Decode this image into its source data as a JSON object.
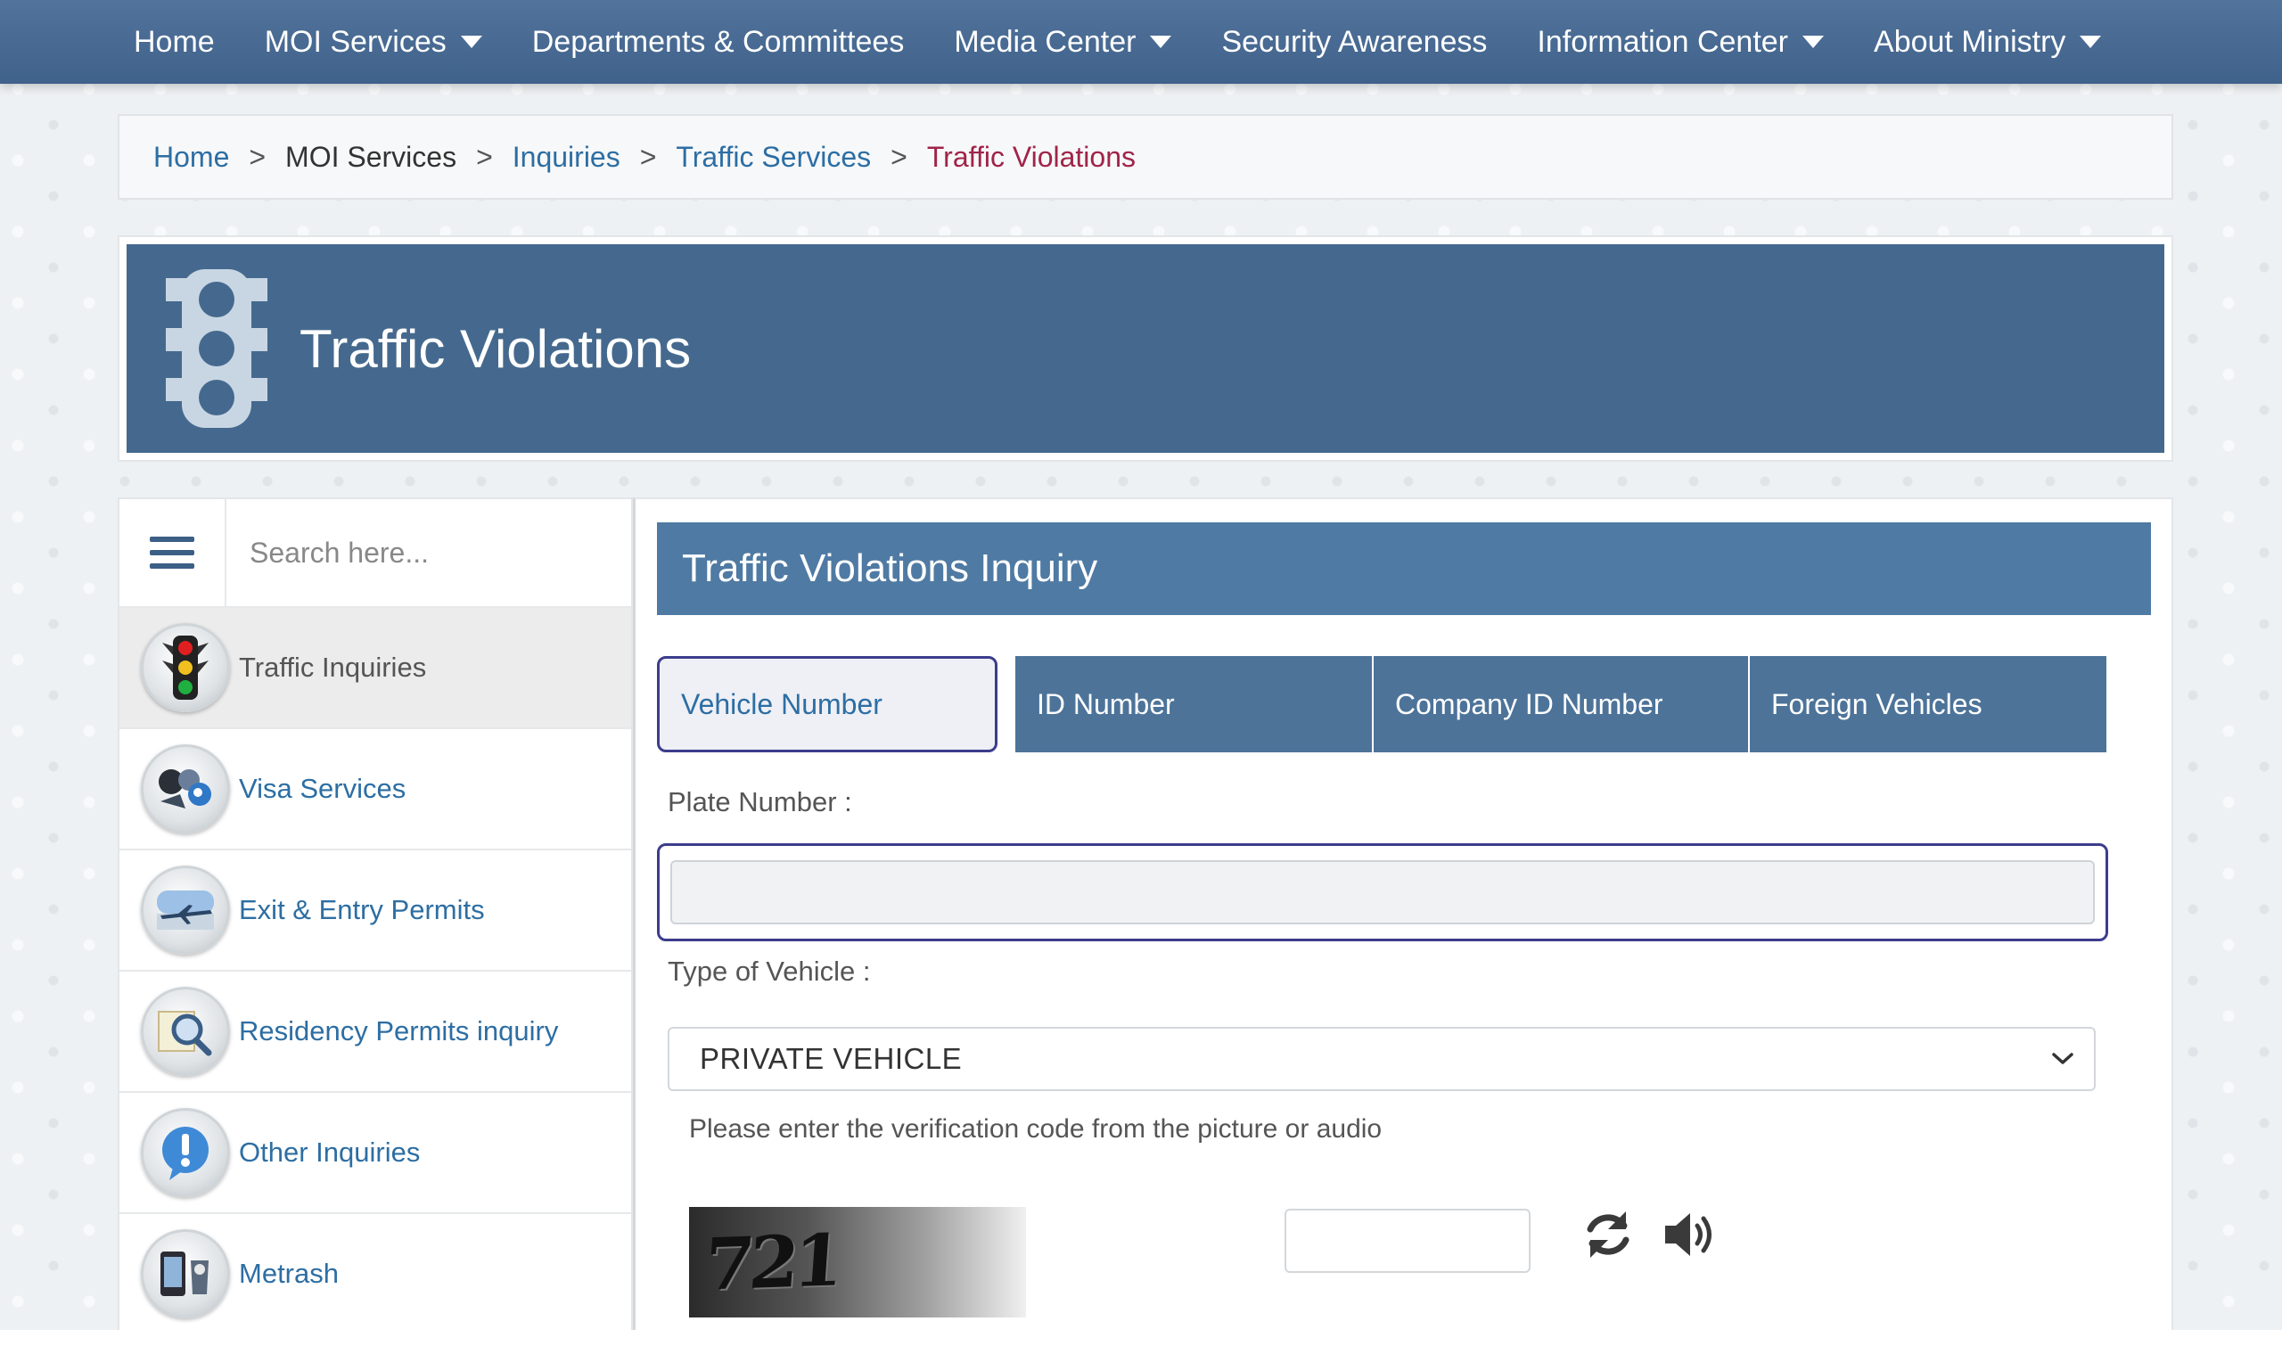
{
  "nav": {
    "items": [
      {
        "label": "Home",
        "dropdown": false
      },
      {
        "label": "MOI Services",
        "dropdown": true
      },
      {
        "label": "Departments & Committees",
        "dropdown": false
      },
      {
        "label": "Media Center",
        "dropdown": true
      },
      {
        "label": "Security Awareness",
        "dropdown": false
      },
      {
        "label": "Information Center",
        "dropdown": true
      },
      {
        "label": "About Ministry",
        "dropdown": true
      }
    ]
  },
  "breadcrumb": {
    "items": [
      "Home",
      "MOI Services",
      "Inquiries",
      "Traffic Services",
      "Traffic Violations"
    ],
    "separator": ">"
  },
  "hero": {
    "title": "Traffic Violations",
    "icon": "traffic-light-icon"
  },
  "sidebar": {
    "search_placeholder": "Search here...",
    "items": [
      {
        "label": "Traffic Inquiries",
        "icon": "traffic-light-icon",
        "active": true
      },
      {
        "label": "Visa Services",
        "icon": "visa-icon",
        "active": false
      },
      {
        "label": "Exit & Entry Permits",
        "icon": "airplane-icon",
        "active": false
      },
      {
        "label": "Residency Permits inquiry",
        "icon": "magnifier-icon",
        "active": false
      },
      {
        "label": "Other Inquiries",
        "icon": "exclamation-icon",
        "active": false
      },
      {
        "label": "Metrash",
        "icon": "metrash-icon",
        "active": false
      }
    ]
  },
  "form": {
    "title": "Traffic Violations Inquiry",
    "tabs": [
      {
        "label": "Vehicle Number",
        "selected": true
      },
      {
        "label": "ID Number",
        "selected": false
      },
      {
        "label": "Company ID Number",
        "selected": false
      },
      {
        "label": "Foreign Vehicles",
        "selected": false
      }
    ],
    "plate_label": "Plate Number :",
    "plate_value": "",
    "vehicle_type_label": "Type of Vehicle :",
    "vehicle_type_value": "PRIVATE VEHICLE",
    "verification_hint": "Please enter the verification code from the picture or audio",
    "captcha_text": "721",
    "captcha_input_value": ""
  },
  "colors": {
    "nav_bg": "#4a6b94",
    "hero_bg": "#45698e",
    "panel_header_bg": "#4f7aa3",
    "tab_bg": "#4d7399",
    "link": "#2d6ea3",
    "current_crumb": "#a02449",
    "focus_border": "#3c3d8c"
  }
}
